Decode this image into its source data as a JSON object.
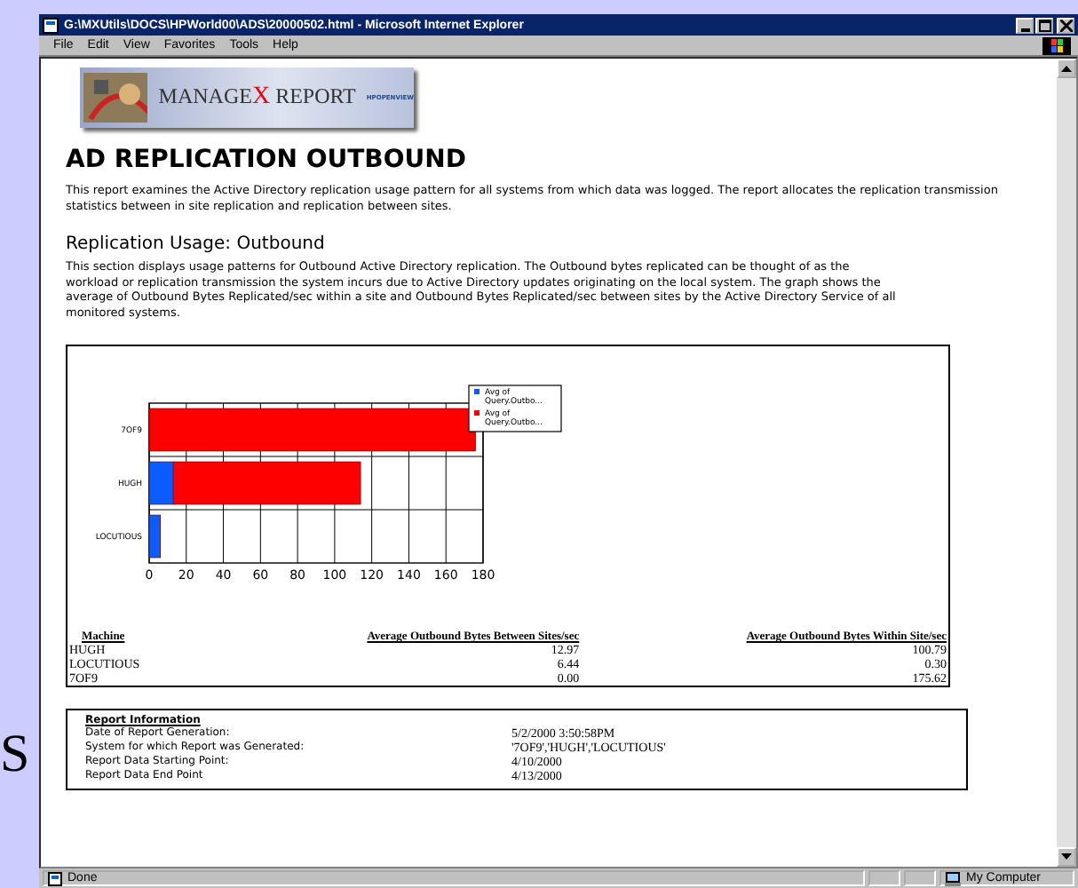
{
  "slide": {
    "letter": "S"
  },
  "window": {
    "title": "G:\\MXUtils\\DOCS\\HPWorld00\\ADS\\20000502.html - Microsoft Internet Explorer"
  },
  "menu": [
    "File",
    "Edit",
    "View",
    "Favorites",
    "Tools",
    "Help"
  ],
  "banner": {
    "title_start": "MANAGE",
    "title_accent": "X",
    "title_end": " REPORT",
    "badge": "HPOPENVIEW"
  },
  "heading": "AD REPLICATION OUTBOUND",
  "intro": "This report examines the Active Directory replication usage pattern for all systems from which data was logged. The report allocates the replication transmission statistics between in site replication and replication between sites.",
  "section": {
    "title": "Replication Usage: Outbound",
    "text": "This section displays usage patterns for Outbound Active Directory replication. The Outbound bytes replicated can be thought of as the workload or replication transmission the system incurs due to Active Directory updates originating on the local system. The graph shows the average of Outbound Bytes Replicated/sec within a site and Outbound Bytes Replicated/sec between sites by the Active Directory Service of all monitored systems."
  },
  "chart": {
    "chart_data": {
      "type": "bar",
      "orientation": "horizontal",
      "stacked": true,
      "categories": [
        "7OF9",
        "HUGH",
        "LOCUTIOUS"
      ],
      "series": [
        {
          "name": "Avg of Query.Outbo...",
          "color": "#0a5cff",
          "values": [
            0,
            13,
            6
          ]
        },
        {
          "name": "Avg of Query.Outbo...",
          "color": "#ff0000",
          "values": [
            176,
            101,
            0
          ]
        }
      ],
      "xlim": [
        0,
        180
      ],
      "grid": true,
      "xticks": [
        0,
        20,
        40,
        60,
        80,
        100,
        120,
        140,
        160,
        180
      ]
    }
  },
  "table": {
    "columns": [
      "Machine",
      "Average Outbound Bytes Between Sites/sec",
      "Average Outbound Bytes Within Site/sec"
    ],
    "rows": [
      [
        "HUGH",
        "12.97",
        "100.79"
      ],
      [
        "LOCUTIOUS",
        "6.44",
        "0.30"
      ],
      [
        "7OF9",
        "0.00",
        "175.62"
      ]
    ]
  },
  "report_info": {
    "title": "Report Information",
    "rows": [
      {
        "label": "Date of Report Generation:",
        "value": "5/2/2000 3:50:58PM"
      },
      {
        "label": "System for which Report was Generated:",
        "value": "'7OF9','HUGH','LOCUTIOUS'"
      },
      {
        "label": "Report Data Starting Point:",
        "value": "4/10/2000"
      },
      {
        "label": "Report Data End Point",
        "value": "4/13/2000"
      }
    ]
  },
  "status_bar": {
    "text": "Done",
    "zone": "My Computer"
  }
}
